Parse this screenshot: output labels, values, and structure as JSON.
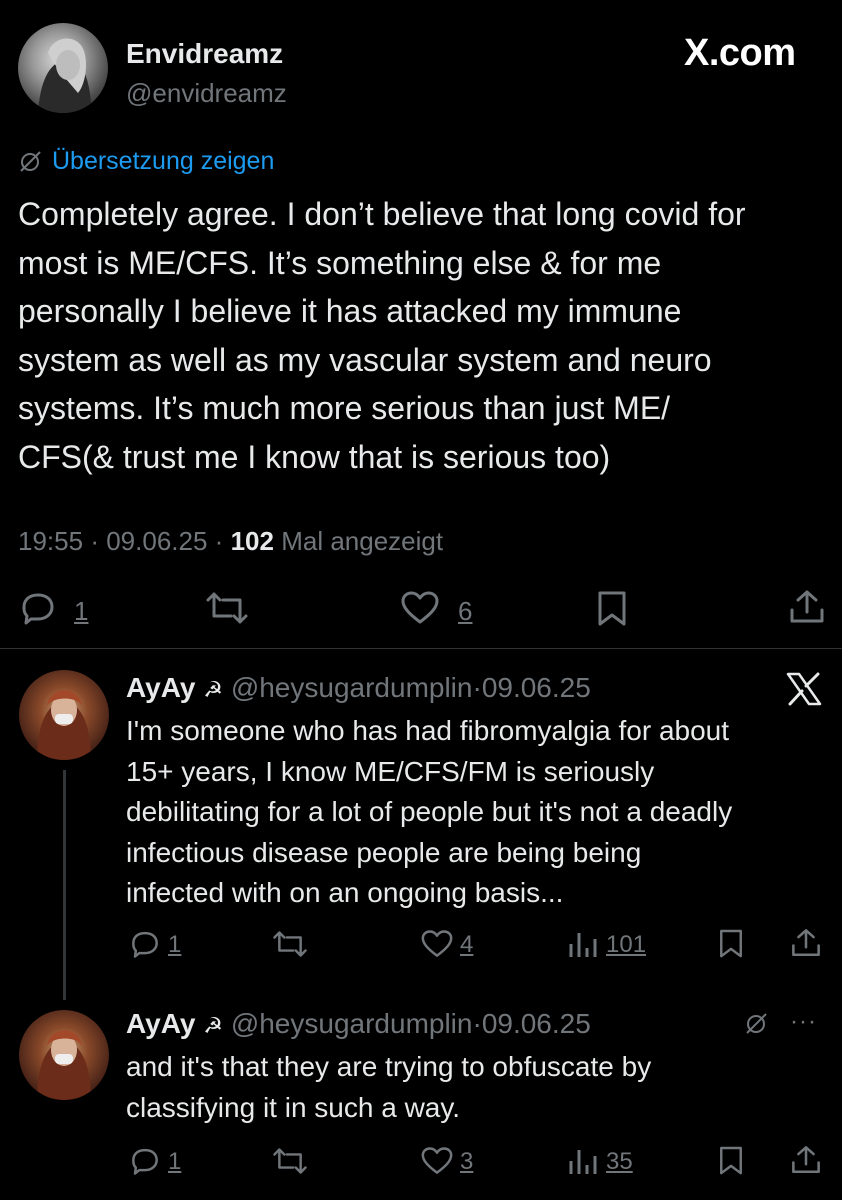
{
  "main_post": {
    "display_name": "Envidreamz",
    "handle": "@envidreamz",
    "watermark": "X.com",
    "translate_label": "Übersetzung zeigen",
    "text_lines": [
      "Completely agree. I don’t believe that long covid for",
      "most is ME/CFS. It’s something else & for me",
      "personally I believe it has attacked my immune",
      "system as well as my vascular system and neuro",
      "systems. It’s much more serious than just ME/",
      "CFS(& trust me I know that is serious too)"
    ],
    "time": "19:55",
    "date": "09.06.25",
    "views_count": "102",
    "views_label": "Mal angezeigt",
    "separator": "·",
    "reply_count": "1",
    "like_count": "6"
  },
  "replies": [
    {
      "display_name": "AyAy",
      "emoji": "☭",
      "handle": "@heysugardumplin",
      "date": "09.06.25",
      "separator": "·",
      "text_lines": [
        "I'm someone who has had fibromyalgia for about",
        "15+ years, I know ME/CFS/FM is seriously",
        "debilitating for a lot of people but it's not a deadly",
        "infectious disease people are being being",
        "infected with on an ongoing basis..."
      ],
      "reply_count": "1",
      "like_count": "4",
      "views_count": "101"
    },
    {
      "display_name": "AyAy",
      "emoji": "☭",
      "handle": "@heysugardumplin",
      "date": "09.06.25",
      "separator": "·",
      "more": "···",
      "text_lines": [
        "and it's that they are trying to obfuscate by",
        "classifying it in such a way."
      ],
      "reply_count": "1",
      "like_count": "3",
      "views_count": "35"
    }
  ]
}
